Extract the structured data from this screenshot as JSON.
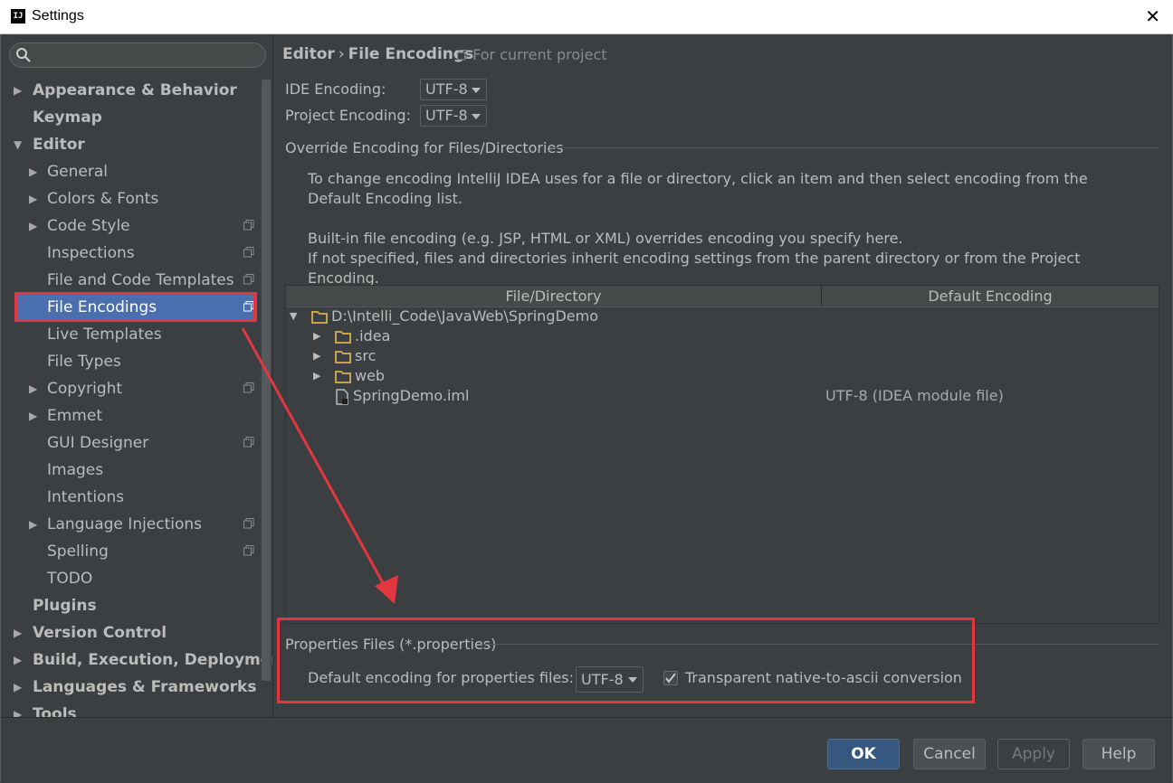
{
  "window": {
    "title": "Settings",
    "app_icon_text": "IJ",
    "close_glyph": "✕"
  },
  "sidebar": {
    "search": {
      "placeholder": "",
      "value": ""
    },
    "items": [
      {
        "label": "Appearance & Behavior",
        "expandable": true,
        "expanded": false,
        "bold": true
      },
      {
        "label": "Keymap",
        "bold": true
      },
      {
        "label": "Editor",
        "expandable": true,
        "expanded": true,
        "bold": true
      },
      {
        "label": "General",
        "expandable": true
      },
      {
        "label": "Colors & Fonts",
        "expandable": true
      },
      {
        "label": "Code Style",
        "expandable": true,
        "project_icon": true
      },
      {
        "label": "Inspections",
        "project_icon": true
      },
      {
        "label": "File and Code Templates",
        "project_icon": true
      },
      {
        "label": "File Encodings",
        "project_icon": true,
        "selected": true
      },
      {
        "label": "Live Templates"
      },
      {
        "label": "File Types"
      },
      {
        "label": "Copyright",
        "expandable": true,
        "project_icon": true
      },
      {
        "label": "Emmet",
        "expandable": true
      },
      {
        "label": "GUI Designer",
        "project_icon": true
      },
      {
        "label": "Images"
      },
      {
        "label": "Intentions"
      },
      {
        "label": "Language Injections",
        "expandable": true,
        "project_icon": true
      },
      {
        "label": "Spelling",
        "project_icon": true
      },
      {
        "label": "TODO"
      },
      {
        "label": "Plugins",
        "bold": true
      },
      {
        "label": "Version Control",
        "expandable": true,
        "bold": true
      },
      {
        "label": "Build, Execution, Deployment",
        "expandable": true,
        "bold": true
      },
      {
        "label": "Languages & Frameworks",
        "expandable": true,
        "bold": true
      },
      {
        "label": "Tools",
        "expandable": true,
        "bold": true
      }
    ]
  },
  "main": {
    "breadcrumb": {
      "parent": "Editor",
      "separator": "›",
      "current": "File Encodings",
      "note": "For current project"
    },
    "ide_encoding": {
      "label": "IDE Encoding:",
      "value": "UTF-8"
    },
    "project_encoding": {
      "label": "Project Encoding:",
      "value": "UTF-8"
    },
    "override_section": {
      "title": "Override Encoding for Files/Directories",
      "help1": "To change encoding IntelliJ IDEA uses for a file or directory, click an item and then select encoding from the Default Encoding list.",
      "help2": "Built-in file encoding (e.g. JSP, HTML or XML) overrides encoding you specify here.",
      "help3": "If not specified, files and directories inherit encoding settings from the parent directory or from the Project Encoding."
    },
    "table": {
      "columns": [
        "File/Directory",
        "Default Encoding"
      ],
      "rows": [
        {
          "name": "D:\\Intelli_Code\\JavaWeb\\SpringDemo",
          "encoding": "",
          "type": "folder",
          "expanded": true
        },
        {
          "name": ".idea",
          "encoding": "",
          "type": "folder",
          "expanded": false
        },
        {
          "name": "src",
          "encoding": "",
          "type": "folder",
          "expanded": false
        },
        {
          "name": "web",
          "encoding": "",
          "type": "folder",
          "expanded": false
        },
        {
          "name": "SpringDemo.iml",
          "encoding": "UTF-8 (IDEA module file)",
          "type": "file"
        }
      ]
    },
    "properties": {
      "title": "Properties Files (*.properties)",
      "default_label": "Default encoding for properties files:",
      "default_value": "UTF-8",
      "native_ascii_label": "Transparent native-to-ascii conversion",
      "native_ascii_checked": true
    }
  },
  "buttons": {
    "ok": "OK",
    "cancel": "Cancel",
    "apply": "Apply",
    "help": "Help"
  },
  "colors": {
    "background": "#3c3f41",
    "selection": "#4b6eaf",
    "annotation_red": "#e3373f",
    "folder": "#c9a24d"
  }
}
